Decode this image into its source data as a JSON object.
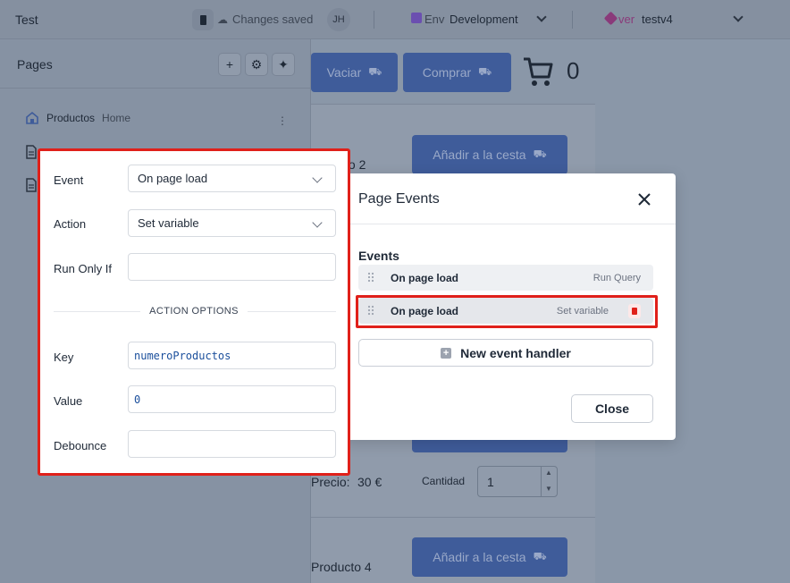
{
  "topbar": {
    "app_title": "Test",
    "save_status": "Changes saved",
    "avatar_initials": "JH",
    "env_label": "Env",
    "env_value": "Development",
    "version_label": "ver",
    "version_value": "testv4",
    "icons": [
      "save-icon",
      "cloud-icon",
      "env-icon",
      "version-icon",
      "chevron-down-icon"
    ]
  },
  "pages_panel": {
    "title": "Pages",
    "buttons": [
      "add-icon",
      "gear-icon",
      "pin-icon"
    ],
    "pages": [
      {
        "name": "Productos",
        "badge": "Home",
        "icon": "home-icon"
      },
      {
        "name": "",
        "badge": "",
        "icon": "file-icon"
      },
      {
        "name": "",
        "badge": "",
        "icon": "file-icon"
      }
    ]
  },
  "canvas": {
    "vaciar_label": "Vaciar",
    "comprar_label": "Comprar",
    "cart_count": "0",
    "add_to_cart_label": "Añadir a la cesta",
    "product_2_label": "to 2",
    "product_4_label": "Producto 4",
    "price_label": "Precio:",
    "price_value": "30 €",
    "quantity_label": "Cantidad",
    "quantity_value": "1"
  },
  "event_editor": {
    "event_label": "Event",
    "event_value": "On page load",
    "action_label": "Action",
    "action_value": "Set variable",
    "run_only_if_label": "Run Only If",
    "run_only_if_value": "",
    "action_options_label": "ACTION OPTIONS",
    "key_label": "Key",
    "key_value": "numeroProductos",
    "value_label": "Value",
    "value_value": "0",
    "debounce_label": "Debounce",
    "debounce_value": ""
  },
  "page_events_modal": {
    "title": "Page Events",
    "events_label": "Events",
    "events": [
      {
        "name": "On page load",
        "action": "Run Query"
      },
      {
        "name": "On page load",
        "action": "Set variable"
      }
    ],
    "new_handler_label": "New event handler",
    "close_label": "Close"
  },
  "colors": {
    "highlight": "#e0201a",
    "primary_button": "#3f5c9a",
    "overlay": "#8a97a8"
  }
}
